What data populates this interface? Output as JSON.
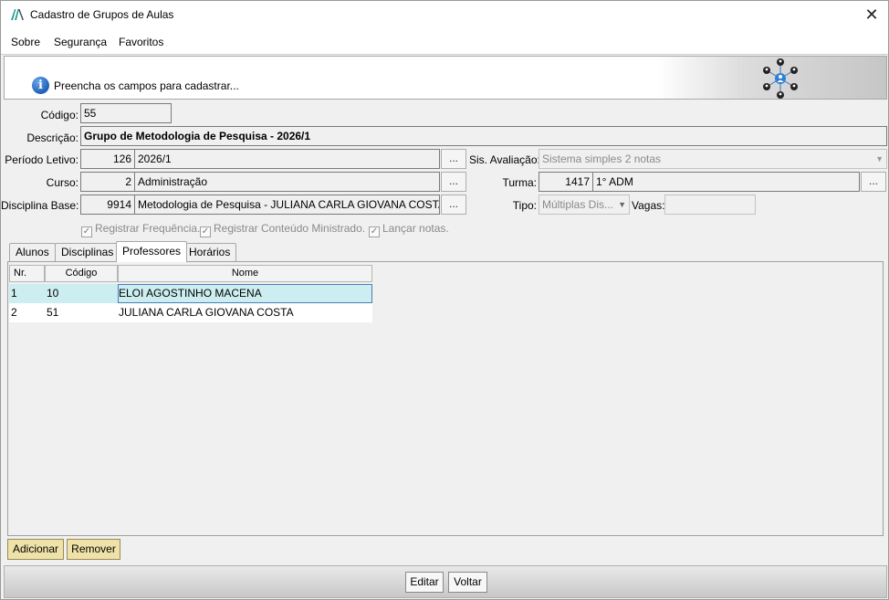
{
  "window": {
    "title": "Cadastro de Grupos de Aulas"
  },
  "menu": {
    "items": [
      "Sobre",
      "Segurança",
      "Favoritos"
    ]
  },
  "banner": {
    "text": "Preencha os campos para cadastrar..."
  },
  "form": {
    "codigo": {
      "label": "Código:",
      "value": "55"
    },
    "descricao": {
      "label": "Descrição:",
      "value": "Grupo de Metodologia de Pesquisa - 2026/1"
    },
    "periodo": {
      "label": "Período Letivo:",
      "code": "126",
      "value": "2026/1"
    },
    "sis_avaliacao": {
      "label": "Sis. Avaliação:",
      "value": "Sistema simples 2 notas"
    },
    "curso": {
      "label": "Curso:",
      "code": "2",
      "value": "Administração"
    },
    "turma": {
      "label": "Turma:",
      "code": "1417",
      "value": "1° ADM"
    },
    "disciplina_base": {
      "label": "Disciplina Base:",
      "code": "9914",
      "value": "Metodologia de Pesquisa - JULIANA CARLA GIOVANA COSTA"
    },
    "tipo": {
      "label": "Tipo:",
      "value": "Múltiplas Dis..."
    },
    "vagas": {
      "label": "Vagas:",
      "value": ""
    },
    "ellipsis": "...",
    "checkboxes": [
      "Registrar Frequência.",
      "Registrar Conteúdo Ministrado.",
      "Lançar notas."
    ]
  },
  "tabs": [
    "Alunos",
    "Disciplinas",
    "Professores",
    "Horários"
  ],
  "grid": {
    "headers": [
      "Nr.",
      "Código",
      "Nome"
    ],
    "rows": [
      {
        "nr": "1",
        "codigo": "10",
        "nome": "ELOI AGOSTINHO MACENA"
      },
      {
        "nr": "2",
        "codigo": "51",
        "nome": "JULIANA CARLA GIOVANA COSTA"
      }
    ]
  },
  "actions": {
    "adicionar": "Adicionar",
    "remover": "Remover",
    "editar": "Editar",
    "voltar": "Voltar"
  },
  "colors": {
    "selected_row": "#cdeef0",
    "action_button": "#efe2a8",
    "info_icon": "#1f5fb8",
    "app_icon": "#2a9d8f"
  }
}
